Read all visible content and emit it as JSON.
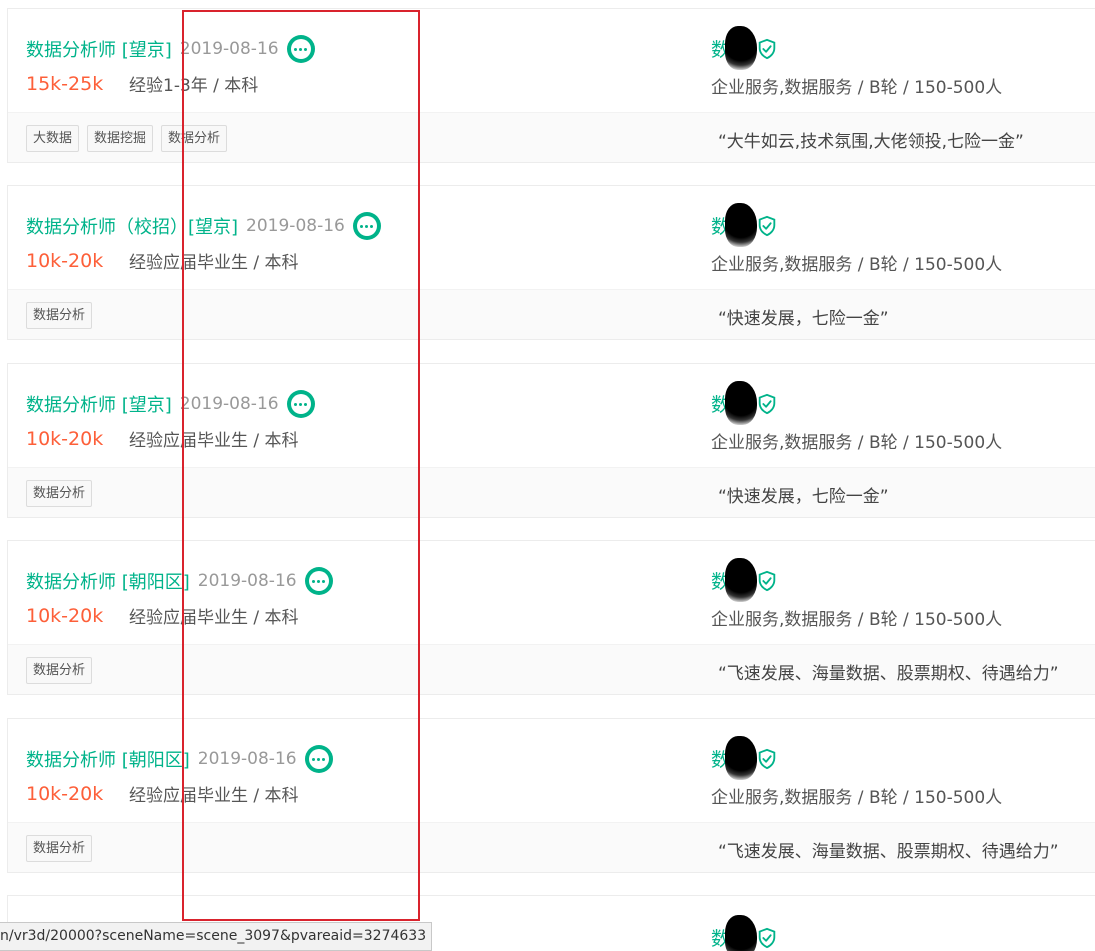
{
  "status_bar_url": "n/vr3d/20000?sceneName=scene_3097&pvareaid=3274633",
  "colors": {
    "accent": "#00b38a",
    "salary": "#fd5f39",
    "highlight_border": "#d9232d"
  },
  "jobs": [
    {
      "title": "数据分析师 [望京]",
      "date": "2019-08-16",
      "salary": "15k-25k",
      "requirement": "经验1-3年 / 本科",
      "tags": [
        "大数据",
        "数据挖掘",
        "数据分析"
      ],
      "company_prefix": "数",
      "industry": "企业服务,数据服务 / B轮 / 150-500人",
      "benefit": "“大牛如云,技术氛围,大佬领投,七险一金”"
    },
    {
      "title": "数据分析师（校招）[望京]",
      "date": "2019-08-16",
      "salary": "10k-20k",
      "requirement": "经验应届毕业生 / 本科",
      "tags": [
        "数据分析"
      ],
      "company_prefix": "数",
      "industry": "企业服务,数据服务 / B轮 / 150-500人",
      "benefit": "“快速发展，七险一金”"
    },
    {
      "title": "数据分析师 [望京]",
      "date": "2019-08-16",
      "salary": "10k-20k",
      "requirement": "经验应届毕业生 / 本科",
      "tags": [
        "数据分析"
      ],
      "company_prefix": "数",
      "industry": "企业服务,数据服务 / B轮 / 150-500人",
      "benefit": "“快速发展，七险一金”"
    },
    {
      "title": "数据分析师 [朝阳区]",
      "date": "2019-08-16",
      "salary": "10k-20k",
      "requirement": "经验应届毕业生 / 本科",
      "tags": [
        "数据分析"
      ],
      "company_prefix": "数",
      "industry": "企业服务,数据服务 / B轮 / 150-500人",
      "benefit": "“飞速发展、海量数据、股票期权、待遇给力”"
    },
    {
      "title": "数据分析师 [朝阳区]",
      "date": "2019-08-16",
      "salary": "10k-20k",
      "requirement": "经验应届毕业生 / 本科",
      "tags": [
        "数据分析"
      ],
      "company_prefix": "数",
      "industry": "企业服务,数据服务 / B轮 / 150-500人",
      "benefit": "“飞速发展、海量数据、股票期权、待遇给力”"
    }
  ],
  "partial_job": {
    "company_prefix": "数"
  }
}
